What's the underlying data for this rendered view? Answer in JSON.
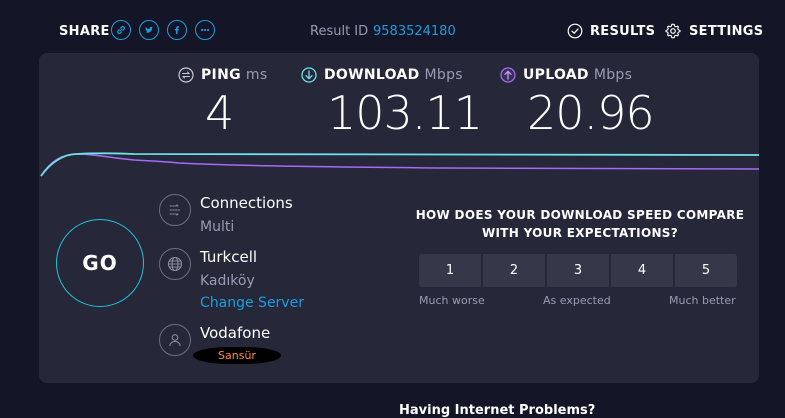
{
  "header": {
    "share_label": "SHARE",
    "share_icons": [
      "link-icon",
      "twitter-icon",
      "facebook-icon",
      "more-icon"
    ],
    "result_label": "Result ID",
    "result_id": "9583524180",
    "results_label": "RESULTS",
    "settings_label": "SETTINGS"
  },
  "metrics": {
    "ping": {
      "label": "PING",
      "unit": "ms",
      "value": "4"
    },
    "download": {
      "label": "DOWNLOAD",
      "unit": "Mbps",
      "value": "103.11"
    },
    "upload": {
      "label": "UPLOAD",
      "unit": "Mbps",
      "value": "20.96"
    }
  },
  "colors": {
    "accent_blue": "#1c9de0",
    "download": "#6fe0e6",
    "upload": "#a56bf5",
    "panel": "#262738",
    "background": "#141526"
  },
  "go_label": "GO",
  "connection": {
    "type_label": "Connections",
    "type_value": "Multi",
    "server_name": "Turkcell",
    "server_location": "Kadıköy",
    "change_server_label": "Change Server",
    "provider_name": "Vodafone",
    "provider_ip_censored": "Sansür"
  },
  "survey": {
    "question": "HOW DOES YOUR DOWNLOAD SPEED COMPARE WITH YOUR EXPECTATIONS?",
    "options": [
      "1",
      "2",
      "3",
      "4",
      "5"
    ],
    "scale_low": "Much worse",
    "scale_mid": "As expected",
    "scale_high": "Much better"
  },
  "footer_text": "Having Internet Problems?"
}
